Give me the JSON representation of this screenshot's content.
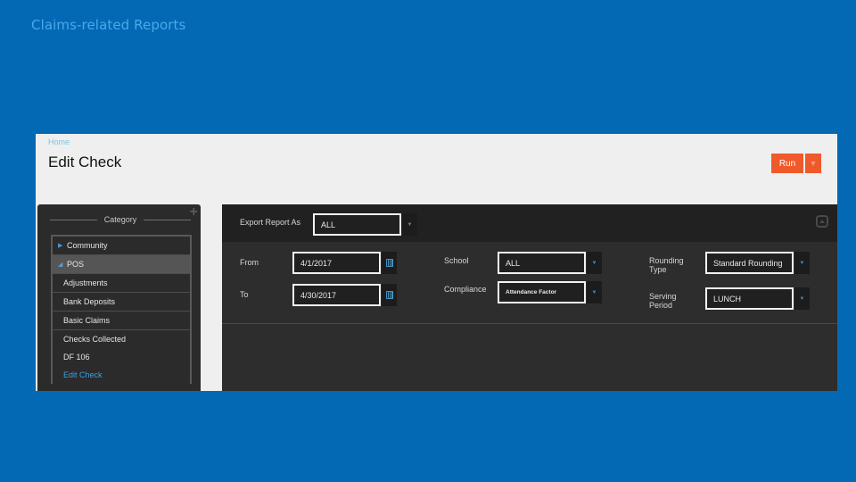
{
  "slide": {
    "title": "Claims-related Reports"
  },
  "screenshot": {
    "breadcrumb": "Home",
    "page_title": "Edit Check",
    "toolbar": {
      "run_label": "Run",
      "more_icon": "caret-down-icon"
    },
    "sidebar": {
      "header": "Category",
      "add_icon": "plus-icon",
      "items": [
        {
          "label": "Community",
          "type": "group",
          "state": "collapsed"
        },
        {
          "label": "POS",
          "type": "group",
          "state": "expanded"
        },
        {
          "label": "Adjustments",
          "type": "report"
        },
        {
          "label": "Bank Deposits",
          "type": "report"
        },
        {
          "label": "Basic Claims",
          "type": "report"
        },
        {
          "label": "Checks Collected",
          "type": "report"
        },
        {
          "label": "DF 106",
          "type": "report"
        },
        {
          "label": "Edit Check",
          "type": "report",
          "active": true
        }
      ]
    },
    "form": {
      "export": {
        "label": "Export Report As",
        "value": "ALL"
      },
      "from": {
        "label": "From",
        "value": "4/1/2017"
      },
      "to": {
        "label": "To",
        "value": "4/30/2017"
      },
      "school": {
        "label": "School",
        "value": "ALL"
      },
      "compliance": {
        "label": "Compliance",
        "value": "Attendance Factor"
      },
      "rounding_type": {
        "label_line1": "Rounding",
        "label_line2": "Type",
        "value": "Standard Rounding"
      },
      "serving_period": {
        "label_line1": "Serving",
        "label_line2": "Period",
        "value": "LUNCH"
      }
    },
    "colors": {
      "accent": "#f0592a",
      "link": "#3ea0e0",
      "slide_bg": "#0369b4"
    }
  }
}
